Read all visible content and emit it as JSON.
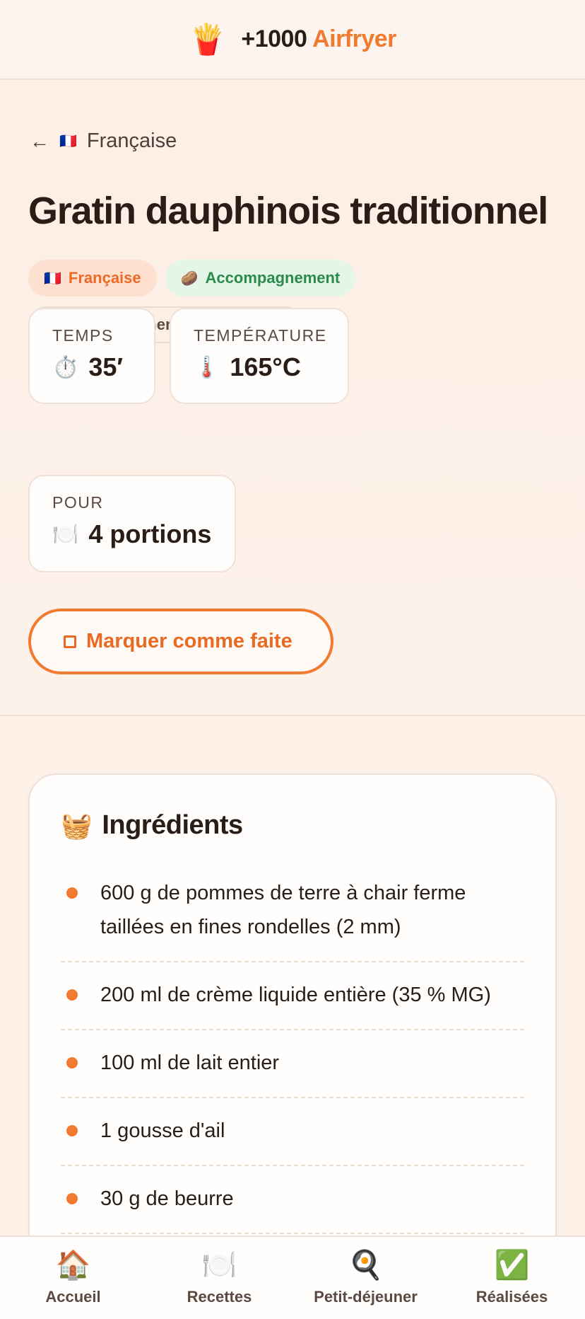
{
  "header": {
    "logo_icon": "🍟",
    "brand_main": "+1000",
    "brand_accent": "Airfryer"
  },
  "back": {
    "arrow": "←",
    "flag": "🇫🇷",
    "label": "Française"
  },
  "recipe": {
    "title": "Gratin dauphinois traditionnel",
    "tags": {
      "cuisine": {
        "icon": "🇫🇷",
        "label": "Française"
      },
      "category": {
        "icon": "🥔",
        "label": "Accompagnement"
      },
      "subcategory": {
        "label": "Accompagnements traditionnels"
      }
    },
    "stats": {
      "time": {
        "label": "TEMPS",
        "icon": "⏱️",
        "value": "35′"
      },
      "temperature": {
        "label": "TEMPÉRATURE",
        "icon": "🌡️",
        "value": "165°C"
      },
      "servings": {
        "label": "POUR",
        "icon": "🍽️",
        "value": "4 portions"
      }
    },
    "mark_done_label": "Marquer comme faite"
  },
  "ingredients": {
    "icon": "🧺",
    "title": "Ingrédients",
    "items": [
      "600 g de pommes de terre à chair ferme taillées en fines rondelles (2 mm)",
      "200 ml de crème liquide entière (35 % MG)",
      "100 ml de lait entier",
      "1 gousse d'ail",
      "30 g de beurre"
    ]
  },
  "nav": [
    {
      "icon": "🏠",
      "label": "Accueil"
    },
    {
      "icon": "🍽️",
      "label": "Recettes"
    },
    {
      "icon": "🍳",
      "label": "Petit-déjeuner"
    },
    {
      "icon": "✅",
      "label": "Réalisées"
    }
  ],
  "colors": {
    "accent": "#f07a2e",
    "green": "#2b8a4a",
    "background": "#fdf1e8"
  }
}
